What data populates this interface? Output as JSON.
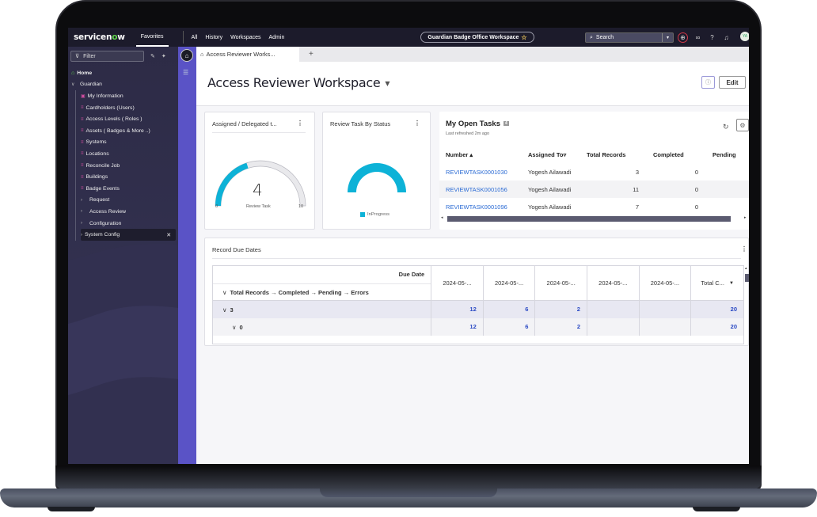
{
  "topnav": {
    "logo_text_before": "servicen",
    "logo_o": "o",
    "logo_text_after": "w",
    "favorites": "Favorites",
    "items": [
      "All",
      "History",
      "Workspaces",
      "Admin"
    ],
    "workspace_pill": "Guardian Badge Office Workspace",
    "search_placeholder": "Search",
    "avatar_initials": "YA"
  },
  "sidebar": {
    "filter_placeholder": "Filter",
    "home": "Home",
    "group": "Guardian",
    "children": [
      "My Information",
      "Cardholders (Users)",
      "Access Levels ( Roles )",
      "Assets ( Badges & More ..)",
      "Systems",
      "Locations",
      "Reconcile Job",
      "Buildings",
      "Badge Events"
    ],
    "collapsed": [
      "Request",
      "Access Review",
      "Configuration",
      "System Config"
    ]
  },
  "tabs": {
    "active": "Access Reviewer Works...",
    "add": "+"
  },
  "page": {
    "title": "Access Reviewer Workspace",
    "edit": "Edit"
  },
  "gauge_card": {
    "title": "Assigned / Delegated t...",
    "value": "4",
    "label": "Review Task",
    "min": "0",
    "max": "10",
    "fraction": 0.4,
    "color": "#0db2d7"
  },
  "status_card": {
    "title": "Review Task By Status",
    "legend": "InProgress",
    "color": "#0db2d7"
  },
  "tasks": {
    "title": "My Open Tasks",
    "count": "4",
    "refreshed": "Last refreshed 2m ago",
    "columns": [
      "Number ▴",
      "Assigned To▿",
      "Total Records",
      "Completed",
      "Pending"
    ],
    "rows": [
      {
        "number": "REVIEWTASK0001030",
        "assigned": "Yogesh Ailawadi",
        "total": "3",
        "completed": "0"
      },
      {
        "number": "REVIEWTASK0001056",
        "assigned": "Yogesh Ailawadi",
        "total": "11",
        "completed": "0"
      },
      {
        "number": "REVIEWTASK0001096",
        "assigned": "Yogesh Ailawadi",
        "total": "7",
        "completed": "0"
      }
    ]
  },
  "due_dates": {
    "title": "Record Due Dates",
    "due_date_label": "Due Date",
    "row_path": "Total Records → Completed → Pending → Errors",
    "columns": [
      "2024-05-...",
      "2024-05-...",
      "2024-05-...",
      "2024-05-...",
      "2024-05-...",
      "Total C..."
    ],
    "rows": [
      {
        "label": "3",
        "values": [
          "12",
          "6",
          "2",
          "",
          "",
          "20"
        ]
      },
      {
        "label": "0",
        "values": [
          "12",
          "6",
          "2",
          "",
          "",
          "20"
        ]
      }
    ]
  }
}
